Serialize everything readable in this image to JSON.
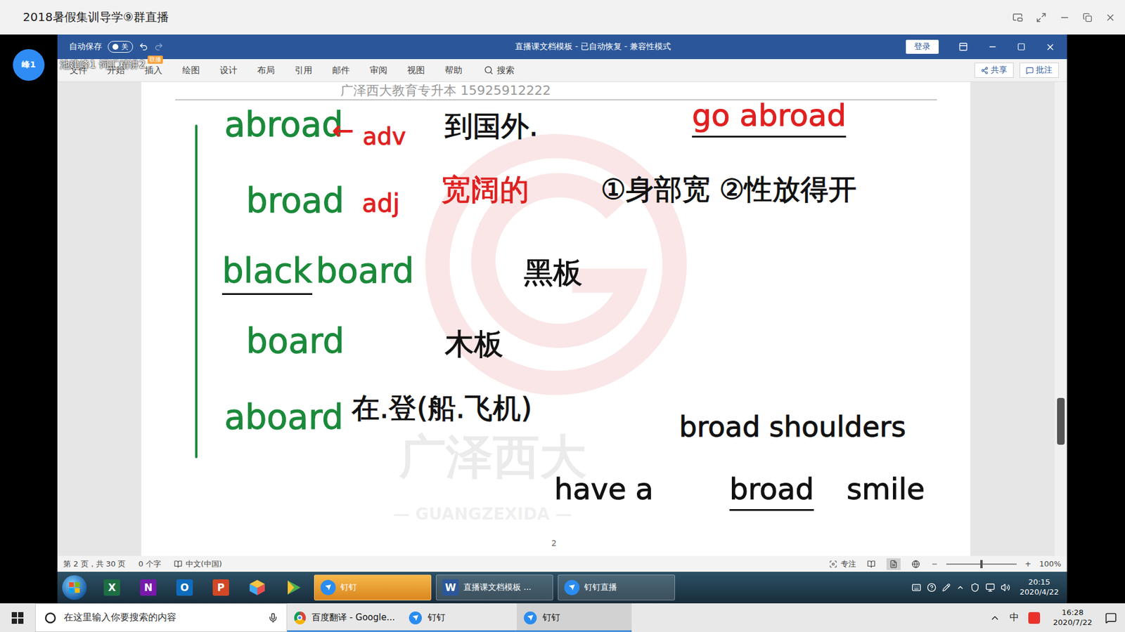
{
  "window": {
    "title": "2018暑假集训导学⑨群直播"
  },
  "avatar": {
    "label": "峰1"
  },
  "live_overlay": {
    "title": "池建峰1 词汇精讲2",
    "badge": "联播"
  },
  "word": {
    "autosave_label": "自动保存",
    "autosave_state": "关",
    "autosave_on": false,
    "title": "直播课文档模板 - 已自动恢复 - 兼容性模式",
    "login": "登录"
  },
  "ribbon": {
    "tabs": [
      "文件",
      "开始",
      "插入",
      "绘图",
      "设计",
      "布局",
      "引用",
      "邮件",
      "审阅",
      "视图",
      "帮助"
    ],
    "search": "搜索",
    "buttons": [
      "共享",
      "批注"
    ]
  },
  "document": {
    "header": "广泽西大教育专升本  15925912222",
    "watermark": "广泽西大",
    "watermark_sub": "— GUANGZEXIDA —",
    "page_number": "2",
    "ink": [
      {
        "text": "abroad",
        "color": "#1a8a3a",
        "underlined": false
      },
      {
        "text": "←",
        "color": "#e02020",
        "underlined": false
      },
      {
        "text": "adv",
        "color": "#e02020",
        "underlined": false
      },
      {
        "text": "到国外.",
        "color": "#111111",
        "underlined": false
      },
      {
        "text": "go abroad",
        "color": "#e02020",
        "underlined": true
      },
      {
        "text": "broad",
        "color": "#1a8a3a",
        "underlined": false
      },
      {
        "text": "adj",
        "color": "#e02020",
        "underlined": false
      },
      {
        "text": "宽阔的",
        "color": "#e02020",
        "underlined": false
      },
      {
        "text": "①身部宽 ②性放得开",
        "color": "#111111",
        "underlined": false
      },
      {
        "text": "black",
        "color": "#1a8a3a",
        "underlined": true
      },
      {
        "text": "board",
        "color": "#1a8a3a",
        "underlined": false
      },
      {
        "text": "黑板",
        "color": "#111111",
        "underlined": false
      },
      {
        "text": "board",
        "color": "#1a8a3a",
        "underlined": false
      },
      {
        "text": "木板",
        "color": "#111111",
        "underlined": false
      },
      {
        "text": "aboard",
        "color": "#1a8a3a",
        "underlined": false
      },
      {
        "text": "在.登(船.飞机)",
        "color": "#111111",
        "underlined": false
      },
      {
        "text": "broad shoulders",
        "color": "#111111",
        "underlined": false
      },
      {
        "text": "have a",
        "color": "#111111",
        "underlined": false
      },
      {
        "text": "broad",
        "color": "#111111",
        "underlined": true
      },
      {
        "text": "smile",
        "color": "#111111",
        "underlined": false
      }
    ]
  },
  "status_bar": {
    "page": "第 2 页，共 30 页",
    "words": "0 个字",
    "language": "中文(中国)",
    "focus": "专注",
    "view_modes": [
      {
        "selected": false
      },
      {
        "selected": true
      },
      {
        "selected": false
      }
    ],
    "zoom": "100%",
    "zoom_level": 0.5
  },
  "remote_taskbar": {
    "apps": [
      {
        "label": "X",
        "color": "#1d6f42"
      },
      {
        "label": "N",
        "color": "#7719aa"
      },
      {
        "label": "O",
        "color": "#0f6cbd"
      },
      {
        "label": "P",
        "color": "#d24726"
      }
    ],
    "buttons": [
      {
        "label": "钉钉",
        "icon_label": "",
        "selected": true
      },
      {
        "label": "直播课文档模板 ...",
        "icon_label": "W",
        "selected": false
      },
      {
        "label": "钉钉直播",
        "icon_label": "",
        "selected": false
      }
    ],
    "time": "20:15",
    "date": "2020/4/22"
  },
  "taskbar": {
    "search_placeholder": "在这里输入你要搜索的内容",
    "items": [
      {
        "label": "百度翻译 - Google...",
        "kind": "chrome",
        "selected": false
      },
      {
        "label": "钉钉",
        "kind": "dingtalk",
        "selected": false
      },
      {
        "label": "钉钉",
        "kind": "dingtalk",
        "selected": true
      }
    ],
    "ime": "中",
    "time": "16:28",
    "date": "2020/7/22"
  }
}
